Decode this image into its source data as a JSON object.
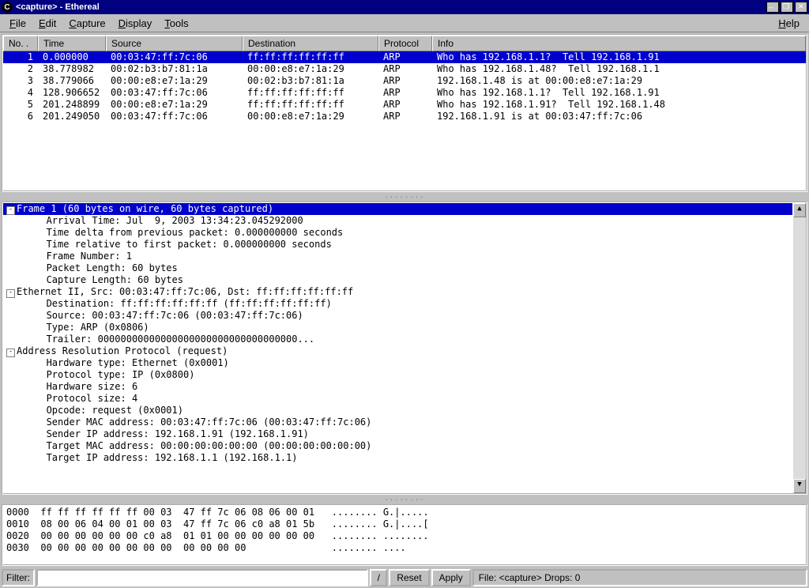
{
  "window": {
    "title": "<capture> - Ethereal",
    "icon_letter": "C"
  },
  "menu": {
    "file": "File",
    "edit": "Edit",
    "capture": "Capture",
    "display": "Display",
    "tools": "Tools",
    "help": "Help"
  },
  "columns": {
    "no": "No. .",
    "time": "Time",
    "source": "Source",
    "destination": "Destination",
    "protocol": "Protocol",
    "info": "Info"
  },
  "packets": [
    {
      "no": "1",
      "time": "0.000000",
      "src": "00:03:47:ff:7c:06",
      "dst": "ff:ff:ff:ff:ff:ff",
      "prot": "ARP",
      "info": "Who has 192.168.1.1?  Tell 192.168.1.91",
      "selected": true
    },
    {
      "no": "2",
      "time": "38.778982",
      "src": "00:02:b3:b7:81:1a",
      "dst": "00:00:e8:e7:1a:29",
      "prot": "ARP",
      "info": "Who has 192.168.1.48?  Tell 192.168.1.1"
    },
    {
      "no": "3",
      "time": "38.779066",
      "src": "00:00:e8:e7:1a:29",
      "dst": "00:02:b3:b7:81:1a",
      "prot": "ARP",
      "info": "192.168.1.48 is at 00:00:e8:e7:1a:29"
    },
    {
      "no": "4",
      "time": "128.906652",
      "src": "00:03:47:ff:7c:06",
      "dst": "ff:ff:ff:ff:ff:ff",
      "prot": "ARP",
      "info": "Who has 192.168.1.1?  Tell 192.168.1.91"
    },
    {
      "no": "5",
      "time": "201.248899",
      "src": "00:00:e8:e7:1a:29",
      "dst": "ff:ff:ff:ff:ff:ff",
      "prot": "ARP",
      "info": "Who has 192.168.1.91?  Tell 192.168.1.48"
    },
    {
      "no": "6",
      "time": "201.249050",
      "src": "00:03:47:ff:7c:06",
      "dst": "00:00:e8:e7:1a:29",
      "prot": "ARP",
      "info": "192.168.1.91 is at 00:03:47:ff:7c:06"
    }
  ],
  "tree": [
    {
      "type": "hdr",
      "exp": "-",
      "text": "Frame 1 (60 bytes on wire, 60 bytes captured)"
    },
    {
      "type": "leaf",
      "indent": 2,
      "text": "Arrival Time: Jul  9, 2003 13:34:23.045292000"
    },
    {
      "type": "leaf",
      "indent": 2,
      "text": "Time delta from previous packet: 0.000000000 seconds"
    },
    {
      "type": "leaf",
      "indent": 2,
      "text": "Time relative to first packet: 0.000000000 seconds"
    },
    {
      "type": "leaf",
      "indent": 2,
      "text": "Frame Number: 1"
    },
    {
      "type": "leaf",
      "indent": 2,
      "text": "Packet Length: 60 bytes"
    },
    {
      "type": "leaf",
      "indent": 2,
      "text": "Capture Length: 60 bytes"
    },
    {
      "type": "node",
      "exp": "-",
      "text": "Ethernet II, Src: 00:03:47:ff:7c:06, Dst: ff:ff:ff:ff:ff:ff"
    },
    {
      "type": "leaf",
      "indent": 2,
      "text": "Destination: ff:ff:ff:ff:ff:ff (ff:ff:ff:ff:ff:ff)"
    },
    {
      "type": "leaf",
      "indent": 2,
      "text": "Source: 00:03:47:ff:7c:06 (00:03:47:ff:7c:06)"
    },
    {
      "type": "leaf",
      "indent": 2,
      "text": "Type: ARP (0x0806)"
    },
    {
      "type": "leaf",
      "indent": 2,
      "text": "Trailer: 00000000000000000000000000000000000..."
    },
    {
      "type": "node",
      "exp": "-",
      "text": "Address Resolution Protocol (request)"
    },
    {
      "type": "leaf",
      "indent": 2,
      "text": "Hardware type: Ethernet (0x0001)"
    },
    {
      "type": "leaf",
      "indent": 2,
      "text": "Protocol type: IP (0x0800)"
    },
    {
      "type": "leaf",
      "indent": 2,
      "text": "Hardware size: 6"
    },
    {
      "type": "leaf",
      "indent": 2,
      "text": "Protocol size: 4"
    },
    {
      "type": "leaf",
      "indent": 2,
      "text": "Opcode: request (0x0001)"
    },
    {
      "type": "leaf",
      "indent": 2,
      "text": "Sender MAC address: 00:03:47:ff:7c:06 (00:03:47:ff:7c:06)"
    },
    {
      "type": "leaf",
      "indent": 2,
      "text": "Sender IP address: 192.168.1.91 (192.168.1.91)"
    },
    {
      "type": "leaf",
      "indent": 2,
      "text": "Target MAC address: 00:00:00:00:00:00 (00:00:00:00:00:00)"
    },
    {
      "type": "leaf",
      "indent": 2,
      "text": "Target IP address: 192.168.1.1 (192.168.1.1)"
    }
  ],
  "hex": [
    "0000  ff ff ff ff ff ff 00 03  47 ff 7c 06 08 06 00 01   ........ G.|.....",
    "0010  08 00 06 04 00 01 00 03  47 ff 7c 06 c0 a8 01 5b   ........ G.|....[",
    "0020  00 00 00 00 00 00 c0 a8  01 01 00 00 00 00 00 00   ........ ........",
    "0030  00 00 00 00 00 00 00 00  00 00 00 00               ........ ...."
  ],
  "filterbar": {
    "label": "Filter:",
    "value": "",
    "dropdown_glyph": "/",
    "reset": "Reset",
    "apply": "Apply",
    "status": "File: <capture>  Drops: 0"
  },
  "gutter_dots": "........"
}
